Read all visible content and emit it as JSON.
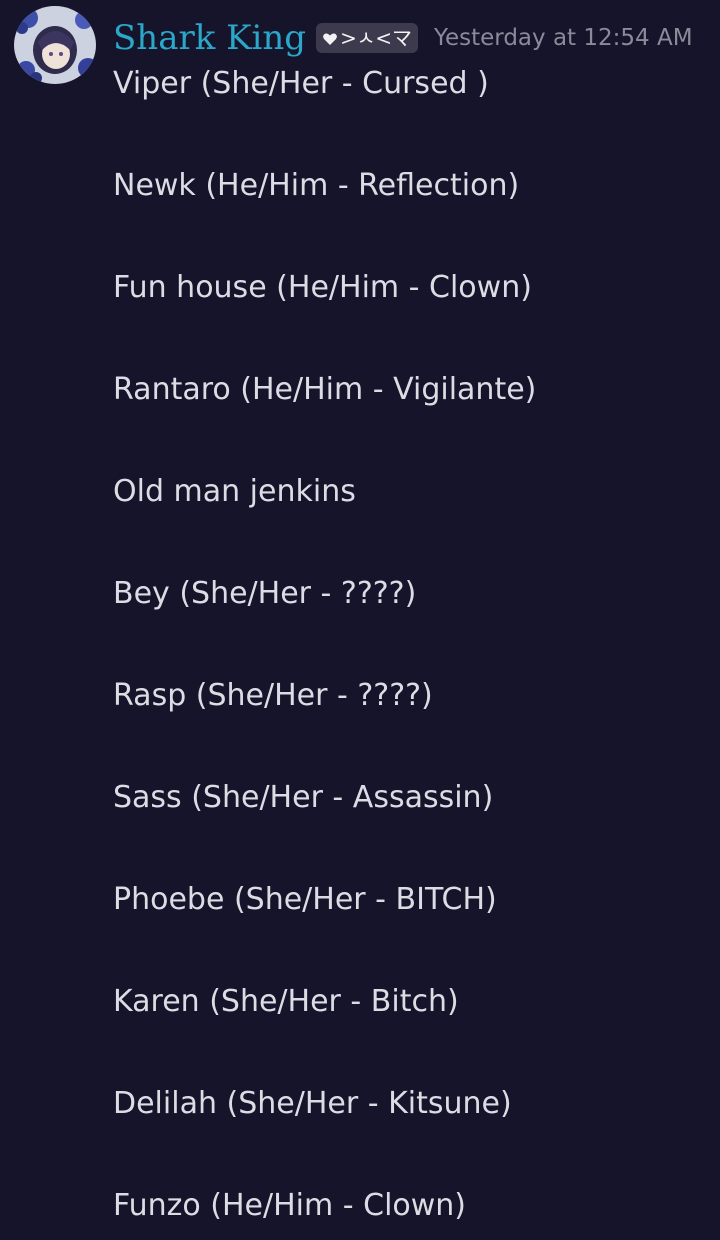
{
  "message": {
    "author": "Shark King",
    "tag": ">ㅅ<マ",
    "tag_icon": "heart-icon",
    "timestamp": "Yesterday at 12:54 AM",
    "lines": [
      "Viper (She/Her - Cursed )",
      "Newk (He/Him - Reflection)",
      "Fun house (He/Him - Clown)",
      "Rantaro (He/Him - Vigilante)",
      "Old man jenkins",
      "Bey (She/Her - ????)",
      "Rasp (She/Her - ????)",
      "Sass (She/Her - Assassin)",
      "Phoebe (She/Her - BITCH)",
      "Karen (She/Her - Bitch)",
      "Delilah (She/Her - Kitsune)",
      "Funzo (He/Him - Clown)"
    ]
  },
  "colors": {
    "background": "#16142a",
    "author": "#2aa7c9",
    "text": "#dcdce4",
    "timestamp": "#8b8a99",
    "tag_bg": "#3c3a4c"
  }
}
